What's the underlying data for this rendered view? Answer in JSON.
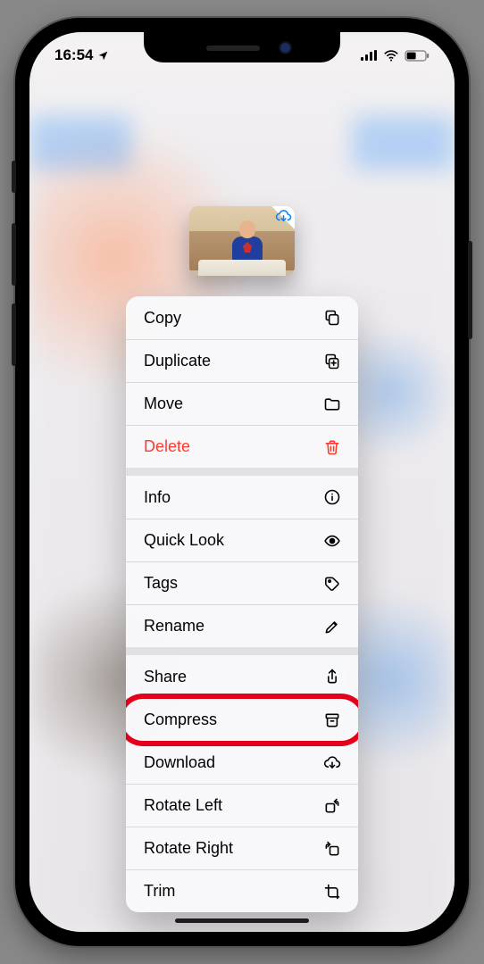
{
  "status": {
    "time": "16:54",
    "location_active": true,
    "cell_bars": 4,
    "wifi": true,
    "battery_level": 0.45
  },
  "preview": {
    "cloud_state": "download"
  },
  "menu": {
    "groups": [
      [
        {
          "key": "copy",
          "label": "Copy",
          "icon": "copy-icon",
          "destructive": false
        },
        {
          "key": "duplicate",
          "label": "Duplicate",
          "icon": "duplicate-icon",
          "destructive": false
        },
        {
          "key": "move",
          "label": "Move",
          "icon": "folder-icon",
          "destructive": false
        },
        {
          "key": "delete",
          "label": "Delete",
          "icon": "trash-icon",
          "destructive": true
        }
      ],
      [
        {
          "key": "info",
          "label": "Info",
          "icon": "info-icon",
          "destructive": false
        },
        {
          "key": "quicklook",
          "label": "Quick Look",
          "icon": "eye-icon",
          "destructive": false
        },
        {
          "key": "tags",
          "label": "Tags",
          "icon": "tag-icon",
          "destructive": false
        },
        {
          "key": "rename",
          "label": "Rename",
          "icon": "pencil-icon",
          "destructive": false
        }
      ],
      [
        {
          "key": "share",
          "label": "Share",
          "icon": "share-icon",
          "destructive": false
        },
        {
          "key": "compress",
          "label": "Compress",
          "icon": "archive-icon",
          "destructive": false,
          "highlight": true
        },
        {
          "key": "download",
          "label": "Download",
          "icon": "download-icon",
          "destructive": false
        },
        {
          "key": "rotate-left",
          "label": "Rotate Left",
          "icon": "rotate-left-icon",
          "destructive": false
        },
        {
          "key": "rotate-right",
          "label": "Rotate Right",
          "icon": "rotate-right-icon",
          "destructive": false
        },
        {
          "key": "trim",
          "label": "Trim",
          "icon": "trim-icon",
          "destructive": false
        }
      ]
    ]
  },
  "annotation": {
    "highlight_key": "compress",
    "color": "#e2001a"
  }
}
